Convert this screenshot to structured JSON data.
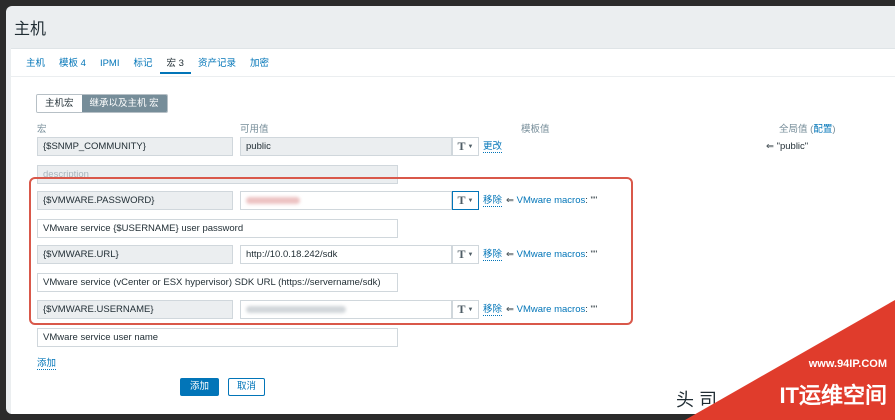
{
  "page": {
    "title": "主机"
  },
  "tabs": [
    {
      "label": "主机"
    },
    {
      "label": "模板 4"
    },
    {
      "label": "IPMI"
    },
    {
      "label": "标记"
    },
    {
      "label": "宏 3"
    },
    {
      "label": "资产记录"
    },
    {
      "label": "加密"
    }
  ],
  "macro_toggle": {
    "host": "主机宏",
    "inherited": "继承以及主机 宏"
  },
  "headers": {
    "macro": "宏",
    "effective_value": "可用值",
    "template_value": "模板值",
    "global_value": "全局值",
    "configure": "配置",
    "open_paren": "(",
    "close_paren": ")"
  },
  "rows": [
    {
      "macro": "{$SNMP_COMMUNITY}",
      "value": "public",
      "action": "更改",
      "description_placeholder": "description",
      "global_value": "⇐ \"public\""
    },
    {
      "macro": "{$VMWARE.PASSWORD}",
      "value": "",
      "action": "移除",
      "inherit_prefix": "⇐",
      "inherit_link": "VMware macros",
      "inherit_value": ": \"\"",
      "description": "VMware service {$USERNAME} user password"
    },
    {
      "macro": "{$VMWARE.URL}",
      "value": "http://10.0.18.242/sdk",
      "action": "移除",
      "inherit_prefix": "⇐",
      "inherit_link": "VMware macros",
      "inherit_value": ": \"\"",
      "description": "VMware service (vCenter or ESX hypervisor) SDK URL (https://servername/sdk)"
    },
    {
      "macro": "{$VMWARE.USERNAME}",
      "value": "",
      "action": "移除",
      "inherit_prefix": "⇐",
      "inherit_link": "VMware macros",
      "inherit_value": ": \"\"",
      "description": "VMware service user name"
    }
  ],
  "type_button": {
    "glyph": "T",
    "caret": "▼"
  },
  "add_link": "添加",
  "buttons": {
    "add": "添加",
    "cancel": "取消"
  },
  "watermark": {
    "url": "www.94IP.COM",
    "text": "IT运维空间",
    "partial": "头 司"
  },
  "colors": {
    "accent": "#0275b8",
    "highlight": "#d9584a",
    "watermark": "#e03c2c"
  }
}
